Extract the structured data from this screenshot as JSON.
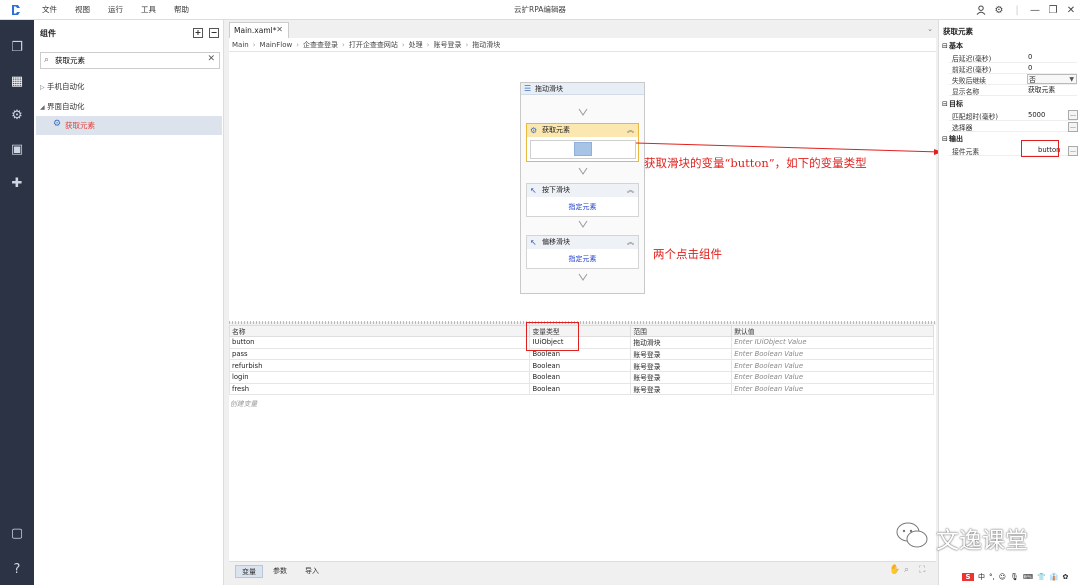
{
  "menu": [
    "文件",
    "视图",
    "运行",
    "工具",
    "帮助"
  ],
  "app_title": "云扩RPA编辑器",
  "components_panel": {
    "title": "组件",
    "expand_all": "+",
    "collapse_all": "−",
    "search_value": "获取元素",
    "tree": [
      {
        "label": "手机自动化",
        "expanded": false
      },
      {
        "label": "界面自动化",
        "expanded": true
      },
      {
        "label": "获取元素",
        "selected": true
      }
    ]
  },
  "tabs": [
    {
      "label": "Main.xaml*"
    }
  ],
  "breadcrumb": [
    "Main",
    "MainFlow",
    "企查查登录",
    "打开企查查网站",
    "处理",
    "账号登录",
    "拖动滑块"
  ],
  "flow": {
    "sequence_title": "拖动滑块",
    "activities": [
      {
        "title": "获取元素",
        "body": "",
        "selected": true
      },
      {
        "title": "按下滑块",
        "body": "指定元素"
      },
      {
        "title": "偏移滑块",
        "body": "指定元素"
      }
    ]
  },
  "annotations": {
    "variable_note": "获取滑块的变量“button”，如下的变量类型",
    "clicks_note": "两个点击组件"
  },
  "variables": {
    "columns": [
      "名称",
      "变量类型",
      "范围",
      "默认值"
    ],
    "rows": [
      {
        "name": "button",
        "type": "IUiObject",
        "scope": "拖动滑块",
        "default": "Enter IUiObject Value"
      },
      {
        "name": "pass",
        "type": "Boolean",
        "scope": "账号登录",
        "default": "Enter Boolean Value"
      },
      {
        "name": "refurbish",
        "type": "Boolean",
        "scope": "账号登录",
        "default": "Enter Boolean Value"
      },
      {
        "name": "login",
        "type": "Boolean",
        "scope": "账号登录",
        "default": "Enter Boolean Value"
      },
      {
        "name": "fresh",
        "type": "Boolean",
        "scope": "账号登录",
        "default": "Enter Boolean Value"
      }
    ],
    "create_hint": "创建变量"
  },
  "bottom_tabs": [
    "变量",
    "参数",
    "导入"
  ],
  "properties": {
    "title": "获取元素",
    "sections": {
      "basic": "基本",
      "target": "目标",
      "output": "输出"
    },
    "basic": [
      {
        "key": "后延迟(毫秒)",
        "value": "0"
      },
      {
        "key": "前延迟(毫秒)",
        "value": "0"
      },
      {
        "key": "失败后继续",
        "value": "否"
      },
      {
        "key": "显示名称",
        "value": "获取元素"
      }
    ],
    "target": [
      {
        "key": "匹配超时(毫秒)",
        "value": "5000"
      },
      {
        "key": "选择器",
        "value": ""
      }
    ],
    "output": [
      {
        "key": "接件元素",
        "value": "button"
      }
    ],
    "browse": "..."
  },
  "watermark": "文逸课堂",
  "tray": [
    "中",
    "°,",
    "☺",
    "🎙",
    "⌨",
    "👕",
    "👔",
    "✿"
  ],
  "colors": {
    "annotation": "#e0201c",
    "rail": "#2b3344",
    "selected_activity": "#fbe7b0",
    "link": "#2140c8"
  }
}
